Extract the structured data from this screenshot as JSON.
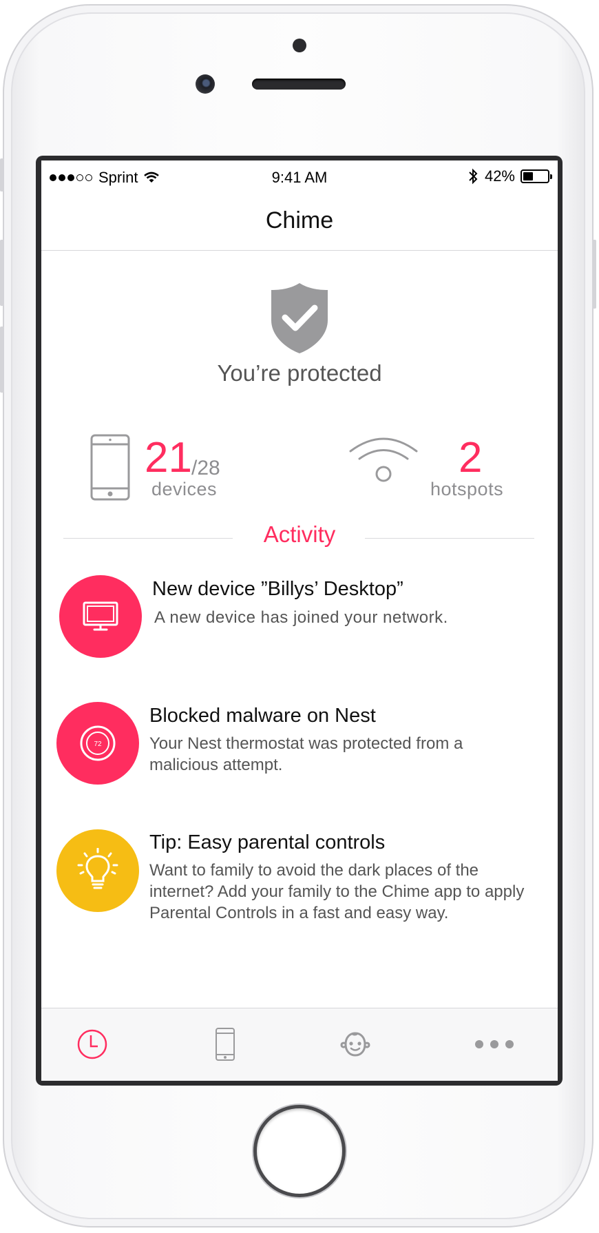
{
  "status_bar": {
    "carrier": "Sprint",
    "time": "9:41 AM",
    "battery_percent": "42%",
    "battery_level": 0.42
  },
  "nav": {
    "title": "Chime"
  },
  "protection": {
    "status_text": "You’re protected"
  },
  "stats": {
    "devices_count": "21",
    "devices_total": "/28",
    "devices_label": "devices",
    "hotspots_count": "2",
    "hotspots_label": "hotspots"
  },
  "activity": {
    "heading": "Activity",
    "items": [
      {
        "title": "New device ”Billys’ Desktop”",
        "description": "A new device has joined your network.",
        "icon": "desktop-icon",
        "color": "#ff2d5f"
      },
      {
        "title": "Blocked malware on Nest",
        "description": "Your Nest thermostat was protected from a malicious attempt.",
        "icon": "thermostat-icon",
        "icon_text": "72",
        "color": "#ff2d5f"
      },
      {
        "title": "Tip: Easy parental controls",
        "description": "Want to family to avoid the dark places of the internet? Add your family to the Chime app to apply Parental Controls in a fast and easy way.",
        "icon": "lightbulb-icon",
        "color": "#f6bd14"
      }
    ]
  },
  "tabs": [
    {
      "name": "activity",
      "icon": "clock-icon",
      "active": true
    },
    {
      "name": "devices",
      "icon": "phone-icon",
      "active": false
    },
    {
      "name": "family",
      "icon": "baby-face-icon",
      "active": false
    },
    {
      "name": "more",
      "icon": "more-dots-icon",
      "active": false
    }
  ],
  "colors": {
    "accent": "#ff2d5f",
    "tip": "#f6bd14",
    "icon_gray": "#9a9a9c"
  }
}
